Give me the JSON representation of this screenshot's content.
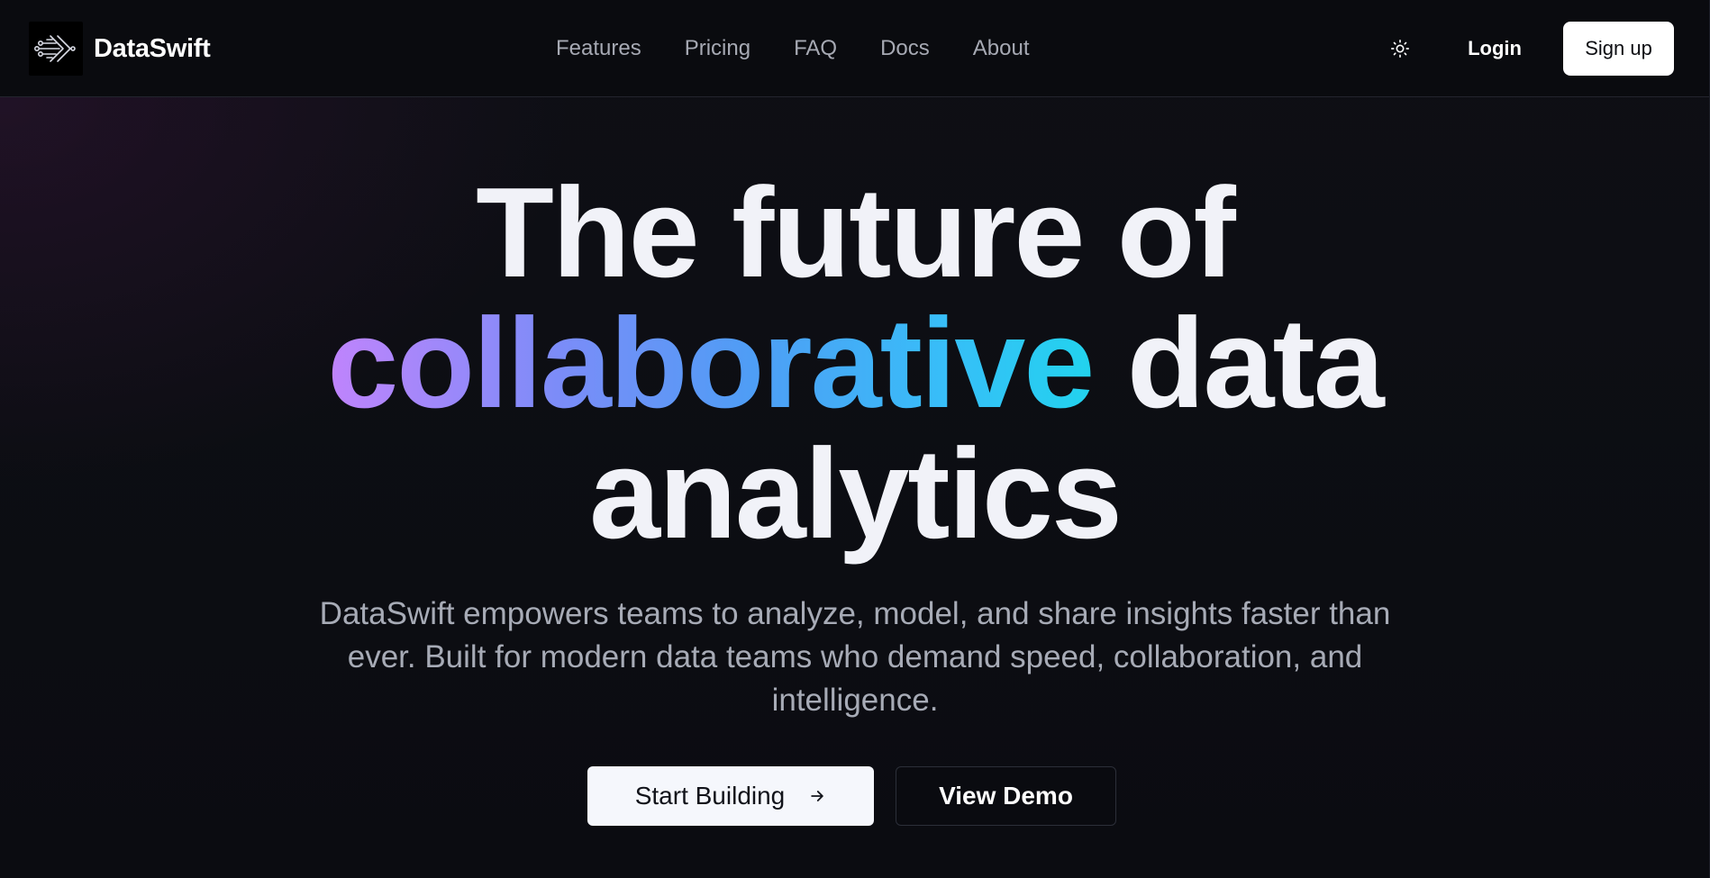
{
  "header": {
    "brand_name": "DataSwift",
    "nav": [
      {
        "label": "Features"
      },
      {
        "label": "Pricing"
      },
      {
        "label": "FAQ"
      },
      {
        "label": "Docs"
      },
      {
        "label": "About"
      }
    ],
    "theme_toggle_icon": "sun-icon",
    "login_label": "Login",
    "signup_label": "Sign up"
  },
  "hero": {
    "title_line1": "The future of",
    "title_highlight": "collaborative",
    "title_line2_rest": "data",
    "title_line3": "analytics",
    "subtitle": "DataSwift empowers teams to analyze, model, and share insights faster than ever. Built for modern data teams who demand speed, collaboration, and intelligence.",
    "primary_cta": "Start Building",
    "primary_cta_icon": "arrow-right-icon",
    "secondary_cta": "View Demo"
  },
  "colors": {
    "background": "#0c0d12",
    "gradient_start": "#c084fc",
    "gradient_end": "#22d3ee",
    "text_primary": "#f1f2f8",
    "text_muted": "#a7abb6"
  }
}
